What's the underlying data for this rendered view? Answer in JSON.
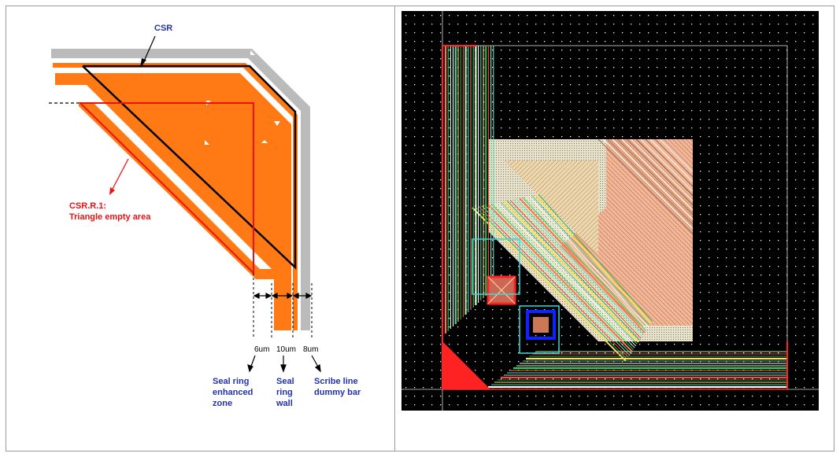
{
  "colors": {
    "seal_ring": "#ff7a14",
    "scribe_line": "#bbbbbb",
    "label_blue": "#2233aa",
    "label_red": "#ee1111",
    "layout_bg": "#000000"
  },
  "diagram": {
    "csr_label": "CSR",
    "rule_label_line1": "CSR.R.1:",
    "rule_label_line2": "Triangle empty area",
    "dim_6um": "6um",
    "dim_10um": "10um",
    "dim_8um": "8um",
    "zone_enhanced": [
      "Seal ring",
      "enhanced",
      "zone"
    ],
    "zone_wall": [
      "Seal",
      "ring",
      "wall"
    ],
    "zone_scribe": [
      "Scribe line",
      "dummy bar"
    ]
  }
}
